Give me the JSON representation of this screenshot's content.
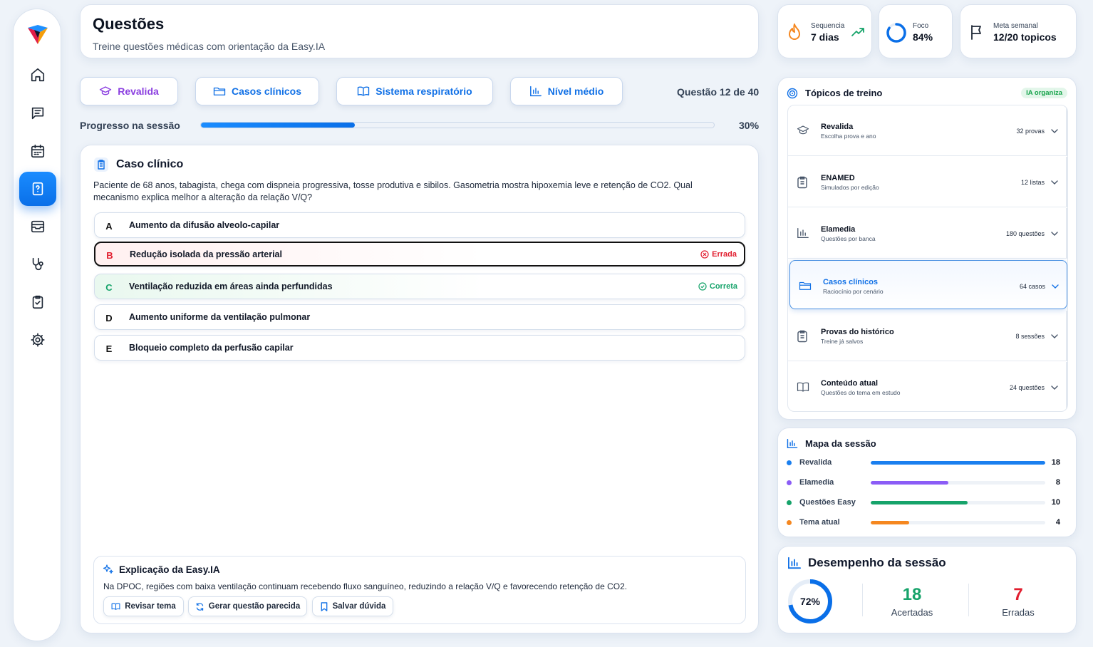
{
  "header": {
    "title": "Questões",
    "subtitle": "Treine questões médicas com orientação da Easy.IA"
  },
  "stats": {
    "streak": {
      "label": "Sequencia",
      "value": "7 dias"
    },
    "focus": {
      "label": "Foco",
      "value": "84%",
      "fraction": 0.84
    },
    "goal": {
      "label": "Meta semanal",
      "value": "12/20 topicos"
    }
  },
  "sidebar": {
    "items": [
      {
        "name": "home",
        "icon": "home-icon"
      },
      {
        "name": "messages",
        "icon": "message-icon"
      },
      {
        "name": "calendar",
        "icon": "calendar-icon"
      },
      {
        "name": "questions",
        "icon": "question-icon",
        "active": true
      },
      {
        "name": "archive",
        "icon": "archive-icon"
      },
      {
        "name": "stethoscope",
        "icon": "stethoscope-icon"
      },
      {
        "name": "checklist",
        "icon": "clipboard-check-icon"
      },
      {
        "name": "settings",
        "icon": "gear-icon"
      }
    ]
  },
  "filters": [
    "Revalida",
    "Casos clínicos",
    "Sistema respiratório",
    "Nível médio"
  ],
  "question_counter": "Questão 12 de 40",
  "progress": {
    "label": "Progresso na sessão",
    "value": "30%",
    "fraction": 0.3
  },
  "question": {
    "section_title": "Caso clínico",
    "text": "Paciente de 68 anos, tabagista, chega com dispneia progressiva, tosse produtiva e sibilos. Gasometria mostra hipoxemia leve e retenção de CO2. Qual mecanismo explica melhor a alteração da relação V/Q?",
    "options": [
      {
        "letter": "A",
        "text": "Aumento da difusão alveolo-capilar",
        "status": ""
      },
      {
        "letter": "B",
        "text": "Redução isolada da pressão arterial",
        "status": "Errada"
      },
      {
        "letter": "C",
        "text": "Ventilação reduzida em áreas ainda perfundidas",
        "status": "Correta"
      },
      {
        "letter": "D",
        "text": "Aumento uniforme da ventilação pulmonar",
        "status": ""
      },
      {
        "letter": "E",
        "text": "Bloqueio completo da perfusão capilar",
        "status": ""
      }
    ]
  },
  "explanation": {
    "title": "Explicação da Easy.IA",
    "text": "Na DPOC, regiões com baixa ventilação continuam recebendo fluxo sanguíneo, reduzindo a relação V/Q e favorecendo retenção de CO2.",
    "buttons": [
      "Revisar tema",
      "Gerar questão parecida",
      "Salvar dúvida"
    ]
  },
  "topics": {
    "title": "Tópicos de treino",
    "badge": "IA organiza",
    "items": [
      {
        "name": "Revalida",
        "sub": "Escolha prova e ano",
        "count": "32 provas",
        "icon": "graduation-cap-icon"
      },
      {
        "name": "ENAMED",
        "sub": "Simulados por edição",
        "count": "12 listas",
        "icon": "clipboard-icon"
      },
      {
        "name": "Elamedia",
        "sub": "Questões por banca",
        "count": "180 questões",
        "icon": "bar-chart-icon"
      },
      {
        "name": "Casos clínicos",
        "sub": "Raciocínio por cenário",
        "count": "64 casos",
        "icon": "folder-icon",
        "selected": true
      },
      {
        "name": "Provas do histórico",
        "sub": "Treine já salvos",
        "count": "8 sessões",
        "icon": "clipboard-icon"
      },
      {
        "name": "Conteúdo atual",
        "sub": "Questões do tema em estudo",
        "count": "24 questões",
        "icon": "book-icon"
      }
    ]
  },
  "session_map": {
    "title": "Mapa da sessão",
    "rows": [
      {
        "label": "Revalida",
        "value": 18,
        "color": "#1a7fef"
      },
      {
        "label": "Elamedia",
        "value": 8,
        "color": "#8b5cf6"
      },
      {
        "label": "Questões Easy",
        "value": 10,
        "color": "#16a36a"
      },
      {
        "label": "Tema atual",
        "value": 4,
        "color": "#f5871f"
      }
    ],
    "max": 18
  },
  "performance": {
    "title": "Desempenho da sessão",
    "accuracy": "72%",
    "accuracy_fraction": 0.72,
    "correct": {
      "value": "18",
      "label": "Acertadas"
    },
    "wrong": {
      "value": "7",
      "label": "Erradas"
    }
  },
  "colors": {
    "primary": "#0a6fe8",
    "purple": "#8b3fe0",
    "success": "#16a36a",
    "danger": "#e11d2e",
    "warning": "#f5871f"
  }
}
